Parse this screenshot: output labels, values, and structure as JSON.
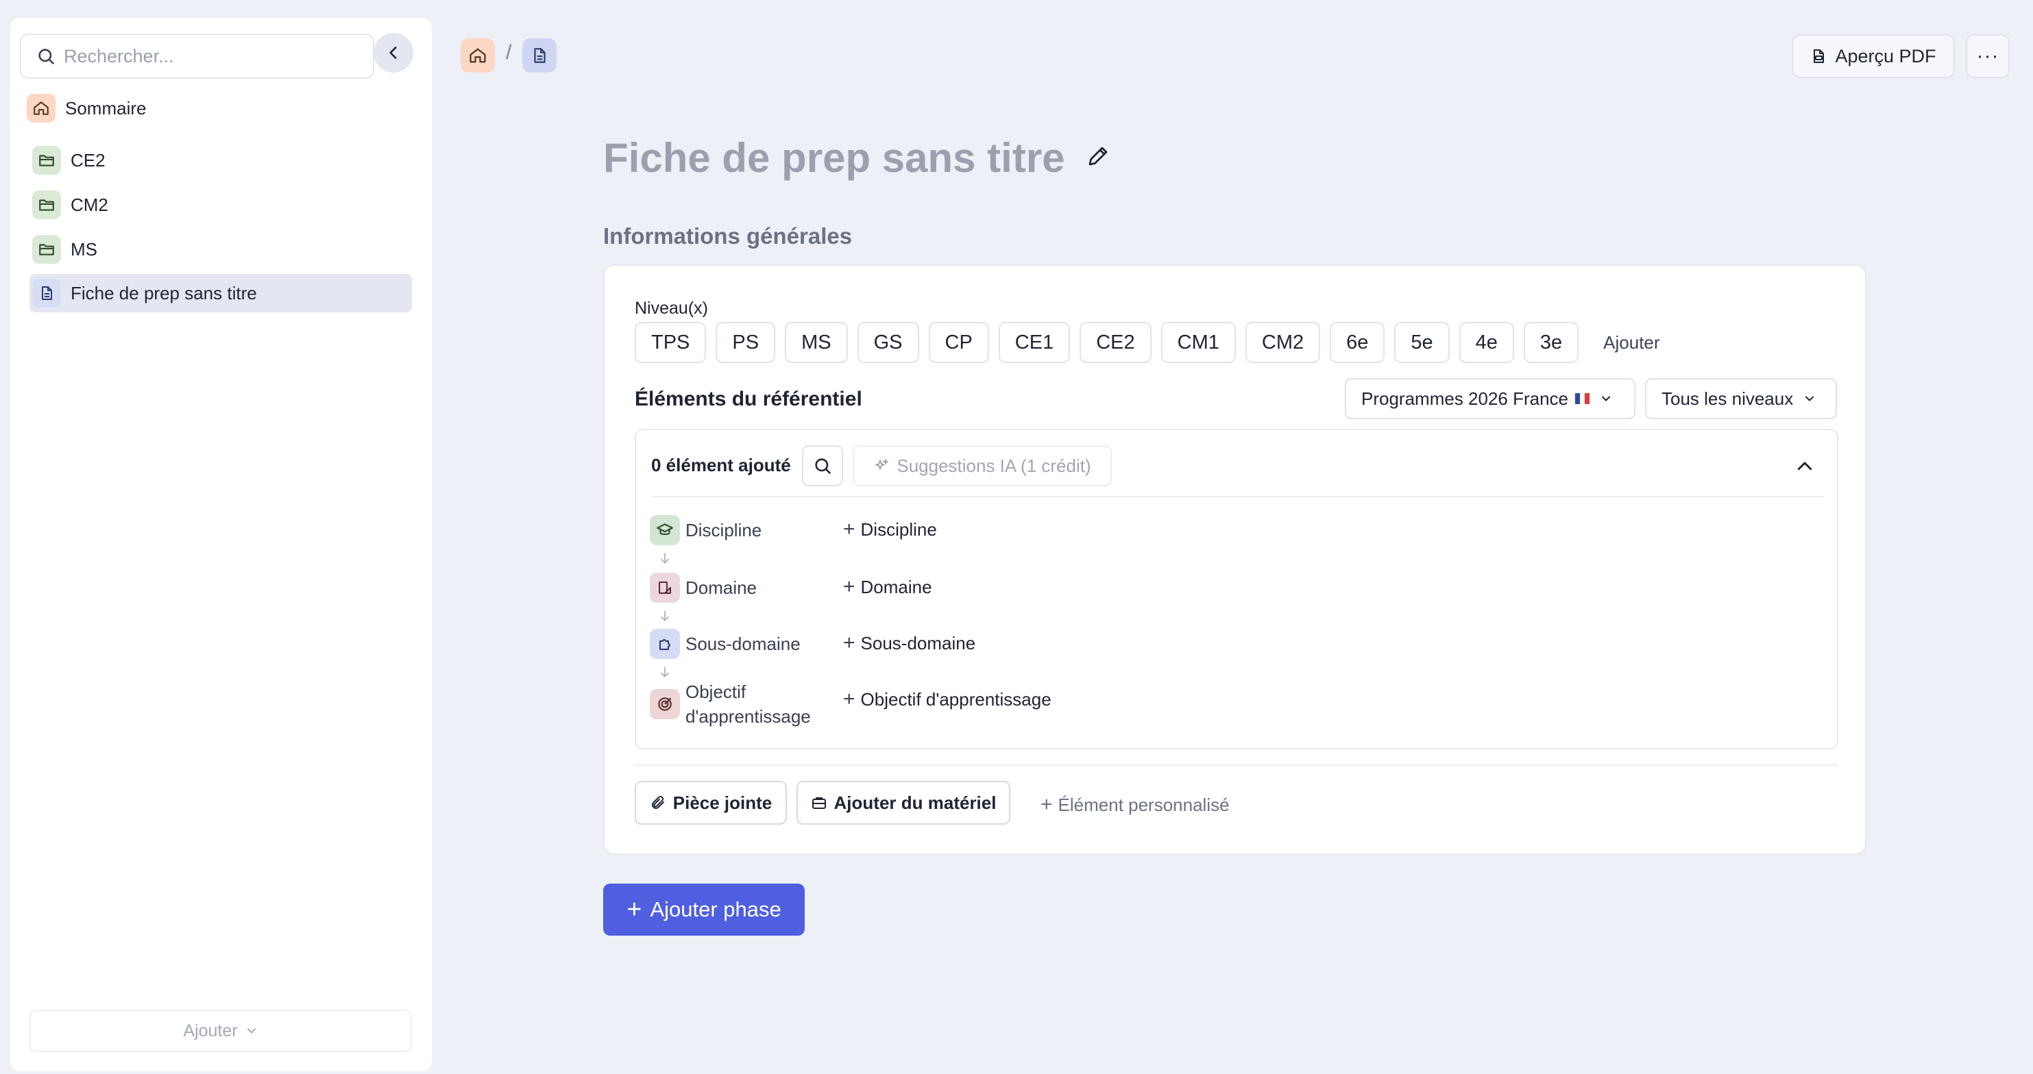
{
  "sidebar": {
    "search_placeholder": "Rechercher...",
    "home": "Sommaire",
    "items": [
      {
        "label": "CE2",
        "icon": "folder-icon"
      },
      {
        "label": "CM2",
        "icon": "folder-icon"
      },
      {
        "label": "MS",
        "icon": "folder-icon"
      },
      {
        "label": "Fiche de prep sans titre",
        "icon": "document-icon"
      }
    ],
    "add_label": "Ajouter"
  },
  "topbar": {
    "breadcrumb_sep": "/",
    "pdf_label": "Aperçu PDF",
    "more_label": "···"
  },
  "main": {
    "title": "Fiche de prep sans titre",
    "section_title": "Informations générales",
    "niveau_label": "Niveau(x)",
    "levels": [
      "TPS",
      "PS",
      "MS",
      "GS",
      "CP",
      "CE1",
      "CE2",
      "CM1",
      "CM2",
      "6e",
      "5e",
      "4e",
      "3e"
    ],
    "levels_add": "Ajouter",
    "referentiel": {
      "title": "Éléments du référentiel",
      "program_select": "Programmes 2026 France",
      "level_select": "Tous les niveaux",
      "count": "0 élément ajouté",
      "ai_suggestions": "Suggestions IA (1 crédit)",
      "hierarchy": [
        {
          "label": "Discipline",
          "add": "Discipline"
        },
        {
          "label": "Domaine",
          "add": "Domaine"
        },
        {
          "label": "Sous-domaine",
          "add": "Sous-domaine"
        },
        {
          "label_line1": "Objectif",
          "label_line2": "d'apprentissage",
          "add": "Objectif d'apprentissage"
        }
      ]
    },
    "footer": {
      "attachment": "Pièce jointe",
      "material": "Ajouter du matériel",
      "custom": "Élément personnalisé"
    },
    "add_phase": "Ajouter phase"
  },
  "colors": {
    "accent": "#4f5fe0",
    "background": "#eef0f7",
    "home_icon_bg": "#fbd7c4",
    "folder_icon_bg": "#dbe9d7",
    "doc_icon_bg": "#d7ddf5"
  }
}
